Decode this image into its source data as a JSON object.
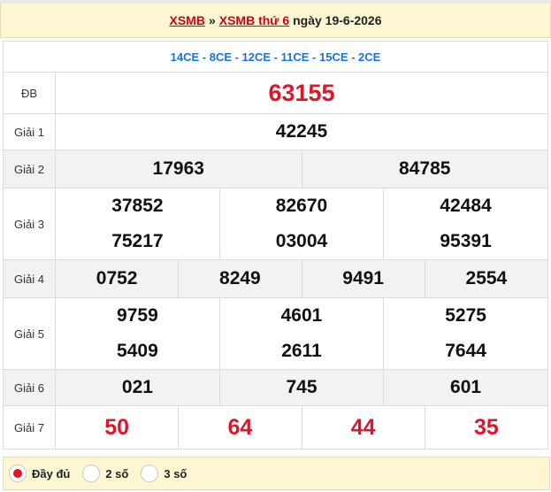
{
  "header": {
    "link1": "XSMB",
    "sep": "»",
    "link2": "XSMB thứ 6",
    "date": "ngày 19-6-2026"
  },
  "codes": "14CE - 8CE - 12CE - 11CE - 15CE - 2CE",
  "prizes": {
    "db": {
      "label": "ĐB",
      "value": "63155"
    },
    "g1": {
      "label": "Giải 1",
      "values": [
        "42245"
      ]
    },
    "g2": {
      "label": "Giải 2",
      "values": [
        "17963",
        "84785"
      ]
    },
    "g3": {
      "label": "Giải 3",
      "values": [
        "37852",
        "82670",
        "42484",
        "75217",
        "03004",
        "95391"
      ]
    },
    "g4": {
      "label": "Giải 4",
      "values": [
        "0752",
        "8249",
        "9491",
        "2554"
      ]
    },
    "g5": {
      "label": "Giải 5",
      "values": [
        "9759",
        "4601",
        "5275",
        "5409",
        "2611",
        "7644"
      ]
    },
    "g6": {
      "label": "Giải 6",
      "values": [
        "021",
        "745",
        "601"
      ]
    },
    "g7": {
      "label": "Giải 7",
      "values": [
        "50",
        "64",
        "44",
        "35"
      ]
    }
  },
  "options": [
    {
      "label": "Đầy đủ",
      "checked": true
    },
    {
      "label": "2 số",
      "checked": false
    },
    {
      "label": "3 số",
      "checked": false
    }
  ],
  "colors": {
    "accent_red": "#e0142a",
    "codes_blue": "#1a73d9",
    "banner_bg": "#fdf6d3"
  }
}
